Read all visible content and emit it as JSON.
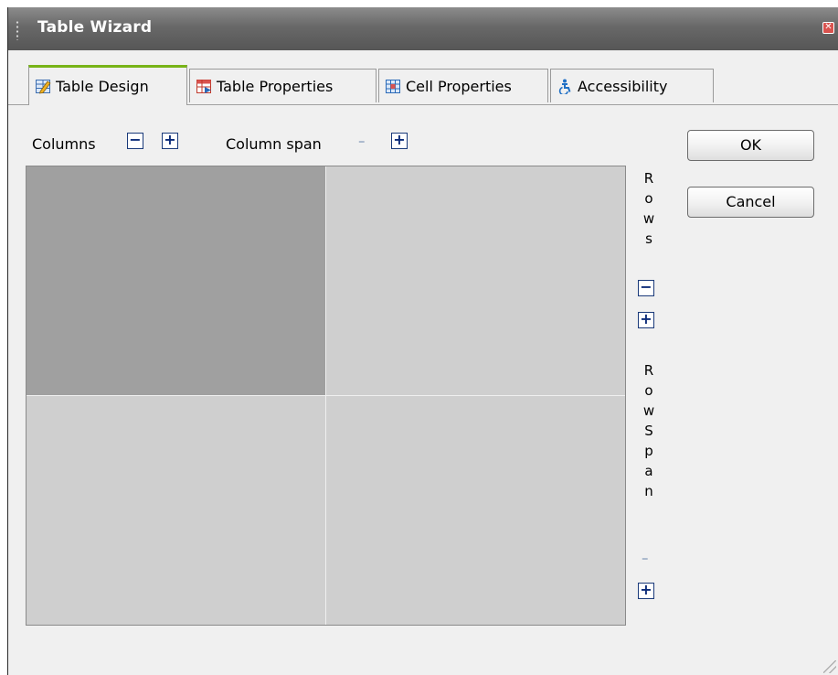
{
  "window": {
    "title": "Table Wizard",
    "close_glyph": "✕"
  },
  "tabs": [
    {
      "label": "Table Design",
      "icon": "table-design-icon",
      "active": true
    },
    {
      "label": "Table Properties",
      "icon": "table-properties-icon",
      "active": false
    },
    {
      "label": "Cell Properties",
      "icon": "cell-properties-icon",
      "active": false
    },
    {
      "label": "Accessibility",
      "icon": "accessibility-icon",
      "active": false
    }
  ],
  "design": {
    "columns_label": "Columns",
    "column_span_label": "Column span",
    "minus_glyph": "−",
    "plus_glyph": "+",
    "disabled_minus_glyph": "–",
    "rows_letters": [
      "R",
      "o",
      "w",
      "s"
    ],
    "rowspan_letters": [
      "R",
      "o",
      "w",
      "S",
      "p",
      "a",
      "n"
    ],
    "grid": {
      "rows": 2,
      "columns": 2,
      "selected_cell": [
        0,
        0
      ]
    }
  },
  "buttons": {
    "ok": "OK",
    "cancel": "Cancel"
  },
  "colors": {
    "titlebar": "#686868",
    "active_tab_accent": "#78b418",
    "cell": "#cfcfcf",
    "selected_cell": "#a0a0a0",
    "control_blue": "#0a2a78"
  }
}
